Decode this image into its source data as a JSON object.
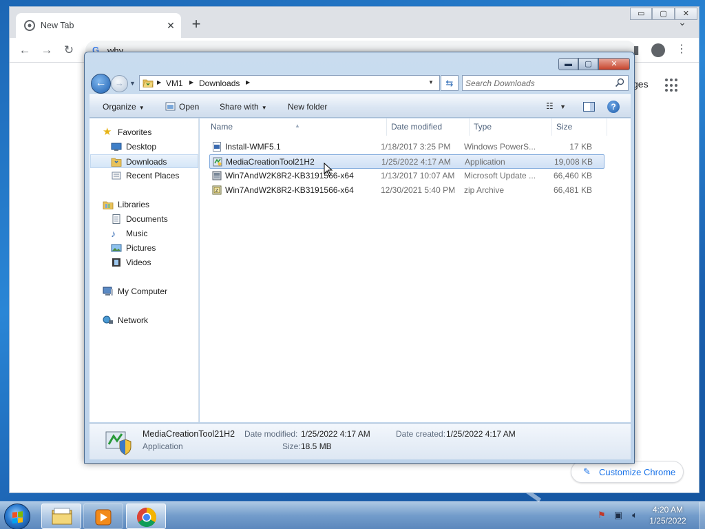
{
  "chrome": {
    "tab_title": "New Tab",
    "tab_close": "✕",
    "new_tab": "+",
    "tab_search": "⌄",
    "omnibox_text": "why",
    "images_link": "ges",
    "customize_label": "Customize Chrome",
    "window_controls": {
      "minimize": "▭",
      "maximize": "▢",
      "close": "✕"
    }
  },
  "explorer": {
    "caption": {
      "minimize": "▬",
      "maximize": "▢",
      "close": "✕"
    },
    "breadcrumb": [
      "VM1",
      "Downloads"
    ],
    "search_placeholder": "Search Downloads",
    "commands": {
      "organize": "Organize",
      "open": "Open",
      "share_with": "Share with",
      "new_folder": "New folder"
    },
    "nav": {
      "favorites": "Favorites",
      "desktop": "Desktop",
      "downloads": "Downloads",
      "recent_places": "Recent Places",
      "libraries": "Libraries",
      "documents": "Documents",
      "music": "Music",
      "pictures": "Pictures",
      "videos": "Videos",
      "my_computer": "My Computer",
      "network": "Network"
    },
    "columns": {
      "name": "Name",
      "date_modified": "Date modified",
      "type": "Type",
      "size": "Size"
    },
    "files": [
      {
        "name": "Install-WMF5.1",
        "date": "1/18/2017 3:25 PM",
        "type": "Windows PowerS...",
        "size": "17 KB"
      },
      {
        "name": "MediaCreationTool21H2",
        "date": "1/25/2022 4:17 AM",
        "type": "Application",
        "size": "19,008 KB"
      },
      {
        "name": "Win7AndW2K8R2-KB3191566-x64",
        "date": "1/13/2017 10:07 AM",
        "type": "Microsoft Update ...",
        "size": "66,460 KB"
      },
      {
        "name": "Win7AndW2K8R2-KB3191566-x64",
        "date": "12/30/2021 5:40 PM",
        "type": "zip Archive",
        "size": "66,481 KB"
      }
    ],
    "details": {
      "name": "MediaCreationTool21H2",
      "type": "Application",
      "date_modified_label": "Date modified:",
      "date_modified": "1/25/2022 4:17 AM",
      "date_created_label": "Date created:",
      "date_created": "1/25/2022 4:17 AM",
      "size_label": "Size:",
      "size": "18.5 MB"
    }
  },
  "taskbar": {
    "time": "4:20 AM",
    "date": "1/25/2022"
  },
  "colors": {
    "chrome_accent": "#1a73e8",
    "selection_border": "#84acdd",
    "desktop": "#2a86d6"
  }
}
